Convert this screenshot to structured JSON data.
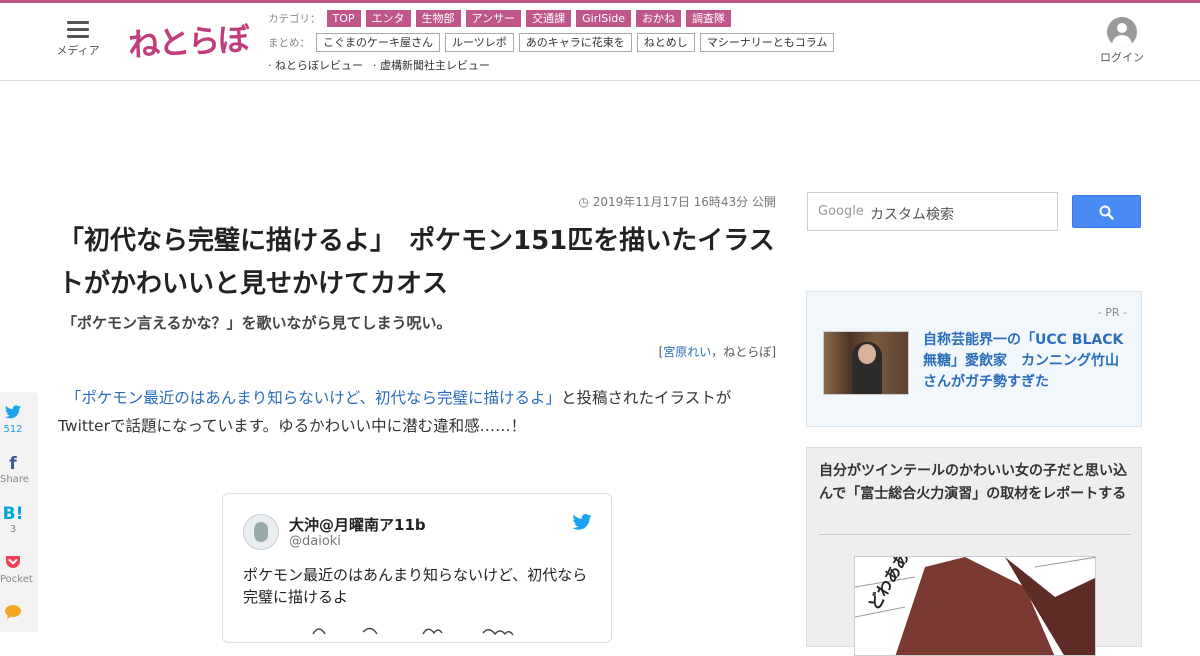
{
  "header": {
    "menu_label": "メディア",
    "logo_text": "ねとらぼ",
    "category_label": "カテゴリ：",
    "categories": [
      "TOP",
      "エンタ",
      "生物部",
      "アンサー",
      "交通課",
      "GirlSide",
      "おかね",
      "調査隊"
    ],
    "matome_label": "まとめ：",
    "matome": [
      "こぐまのケーキ屋さん",
      "ルーツレポ",
      "あのキャラに花束を",
      "ねとめし",
      "マシーナリーともコラム"
    ],
    "reviews": [
      "· ねとらぼレビュー",
      "· 虚構新聞社主レビュー"
    ],
    "login_label": "ログイン"
  },
  "article": {
    "date": "2019年11月17日 16時43分 公開",
    "title": "「初代なら完璧に描けるよ」　ポケモン151匹を描いたイラストがかわいいと見せかけてカオス",
    "subtitle": "「ポケモン言えるかな？」を歌いながら見てしまう呪い。",
    "byline_open": "[",
    "author": "宮原れい",
    "byline_sep": "，",
    "site": "ねとらぼ",
    "byline_close": "]",
    "lead_indent": "　",
    "lead_link": "「ポケモン最近のはあんまり知らないけど、初代なら完璧に描けるよ」",
    "lead_rest": "と投稿されたイラストがTwitterで話題になっています。ゆるかわいい中に潜む違和感……！"
  },
  "share": [
    {
      "icon": "twitter-icon",
      "count": "512"
    },
    {
      "icon": "facebook-icon",
      "count": "Share"
    },
    {
      "icon": "hatena-icon",
      "count": "3"
    },
    {
      "icon": "pocket-icon",
      "count": "Pocket"
    },
    {
      "icon": "comment-icon",
      "count": ""
    }
  ],
  "tweet": {
    "name": "大沖@月曜南ア11b",
    "handle": "@daioki",
    "text": "ポケモン最近のはあんまり知らないけど、初代なら完璧に描けるよ"
  },
  "sidebar": {
    "search_brand": "Google",
    "search_placeholder": "カスタム検索",
    "pr_tag": "- PR -",
    "pr_text": "自称芸能界一の「UCC BLACK無糖」愛飲家　カンニング竹山さんがガチ勢すぎた",
    "related_title": "自分がツインテールのかわいい女の子だと思い込んで「富士総合火力演習」の取材をレポートする",
    "manga_text": "どわああ"
  },
  "colors": {
    "accent": "#c0578a",
    "link": "#2a6ebb",
    "search_button": "#4a8af4"
  }
}
